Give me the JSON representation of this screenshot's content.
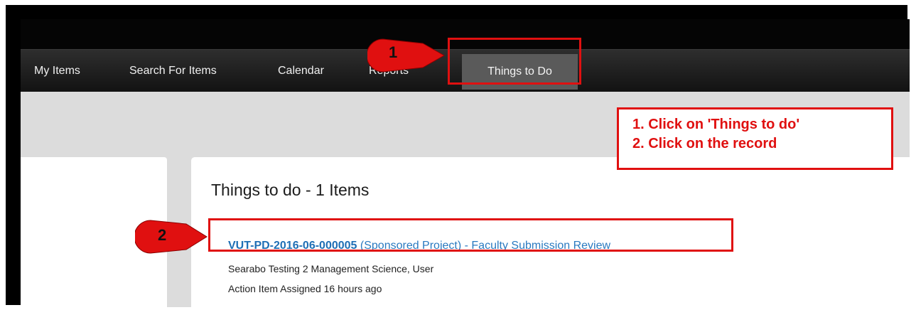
{
  "nav": {
    "items": [
      {
        "label": "My Items"
      },
      {
        "label": "Search For Items"
      },
      {
        "label": "Calendar"
      },
      {
        "label": "Reports"
      }
    ],
    "active": {
      "label": "Things to Do"
    }
  },
  "main": {
    "heading": "Things to do - 1 Items",
    "record": {
      "id": "VUT-PD-2016-06-000005",
      "description": "(Sponsored Project) - Faculty Submission Review",
      "owner": "Searabo Testing 2  Management Science, User",
      "status": "Action Item Assigned 16 hours ago"
    }
  },
  "annotations": {
    "marker1": "1",
    "marker2": "2",
    "instructions": [
      "1. Click on 'Things to do'",
      "2. Click on the record"
    ],
    "colors": {
      "highlight": "#e01010",
      "marker": "#e01010"
    }
  }
}
